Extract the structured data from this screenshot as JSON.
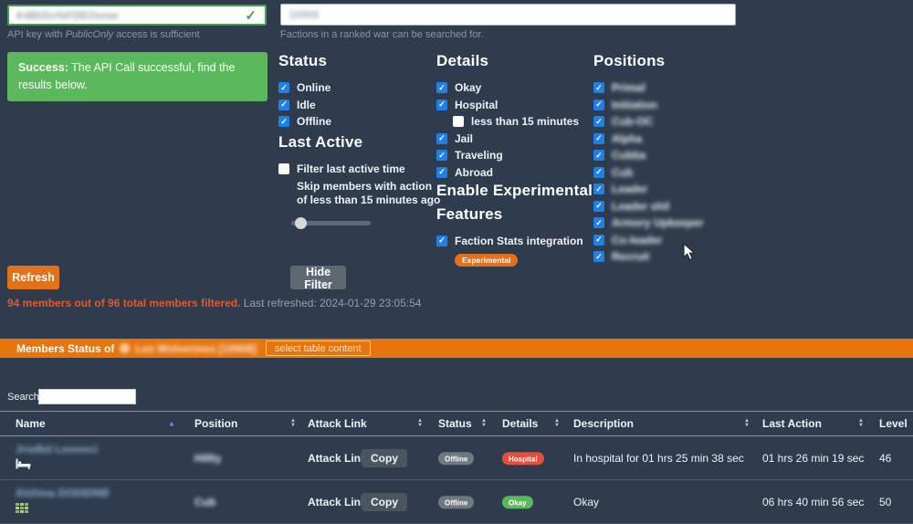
{
  "api_key": {
    "value": "K4BtSo%FDEOnnw",
    "helper_prefix": "API key with ",
    "helper_italic": "PublicOnly",
    "helper_suffix": " access is sufficient"
  },
  "faction_search": {
    "value": "10908",
    "helper": "Factions in a ranked war can be searched for."
  },
  "alert": {
    "prefix": "Success:",
    "message": " The API Call successful, find the results below."
  },
  "filters": {
    "status": {
      "title": "Status",
      "options": [
        {
          "label": "Online",
          "checked": true
        },
        {
          "label": "Idle",
          "checked": true
        },
        {
          "label": "Offline",
          "checked": true
        }
      ]
    },
    "last_active": {
      "title": "Last Active",
      "toggle_label": "Filter last active time",
      "description": "Skip members with action of less than 15 minutes ago",
      "toggle_checked": false
    },
    "details": {
      "title": "Details",
      "options": [
        {
          "label": "Okay",
          "checked": true
        },
        {
          "label": "Hospital",
          "checked": true
        },
        {
          "label": "less than 15 minutes",
          "checked": false
        },
        {
          "label": "Jail",
          "checked": true
        },
        {
          "label": "Traveling",
          "checked": true
        },
        {
          "label": "Abroad",
          "checked": true
        }
      ]
    },
    "experimental": {
      "title": "Enable Experimental Features",
      "toggle_label": "Faction Stats integration",
      "toggle_checked": true,
      "badge": "Experimental"
    },
    "positions": {
      "title": "Positions",
      "redacted": true,
      "options": [
        {
          "label": "Primal",
          "checked": true
        },
        {
          "label": "Initiation",
          "checked": true
        },
        {
          "label": "Cub-OC",
          "checked": true
        },
        {
          "label": "Alpha",
          "checked": true
        },
        {
          "label": "Cubba",
          "checked": true
        },
        {
          "label": "Cub",
          "checked": true
        },
        {
          "label": "Leader",
          "checked": true
        },
        {
          "label": "Leader shil",
          "checked": true
        },
        {
          "label": "Armory Upkeeper",
          "checked": true
        },
        {
          "label": "Co-leader",
          "checked": true
        },
        {
          "label": "Recruit",
          "checked": true
        }
      ]
    }
  },
  "toolbar": {
    "refresh_label": "Refresh",
    "hide_filter_label": "Hide Filter"
  },
  "summary": {
    "filtered_text": "94 members out of 96 total members filtered.",
    "refreshed_text": " Last refreshed: 2024-01-29 23:05:54"
  },
  "members_bar": {
    "title": "Members Status of",
    "faction_name": "Lex Wolverines [10908]",
    "faction_redacted": true,
    "select_button": "select table content"
  },
  "table": {
    "search_label": "Search:",
    "search_value": "",
    "columns": {
      "name": "Name",
      "position": "Position",
      "attack_link": "Attack Link",
      "status": "Status",
      "details": "Details",
      "description": "Description",
      "last_action": "Last Action",
      "level": "Level"
    },
    "rows": [
      {
        "name": "Jrodkd Looooci",
        "name_redacted": true,
        "icon": "hospital-bed",
        "position": "Hillty",
        "attack_link": "Attack Link",
        "copy_label": "Copy",
        "status": "Offline",
        "details": "Hospital",
        "description": "In hospital for 01 hrs 25 min 38 sec",
        "last_action": "01 hrs 26 min 19 sec",
        "level": "46"
      },
      {
        "name": "Alshina DODIDNB",
        "name_redacted": true,
        "icon": "stats-grid",
        "position": "Cub",
        "attack_link": "Attack Link",
        "copy_label": "Copy",
        "status": "Offline",
        "details": "Okay",
        "description": "Okay",
        "last_action": "06 hrs 40 min 56 sec",
        "level": "50"
      }
    ]
  }
}
